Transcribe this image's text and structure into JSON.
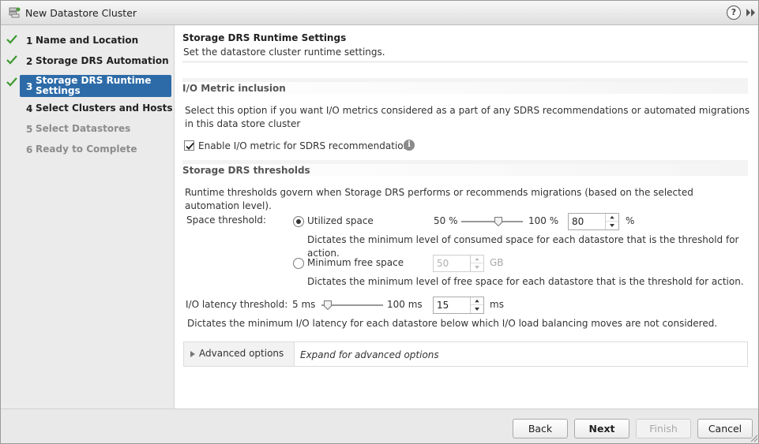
{
  "window": {
    "title": "New Datastore Cluster"
  },
  "steps": [
    {
      "num": "1",
      "label": "Name and Location",
      "state": "done"
    },
    {
      "num": "2",
      "label": "Storage DRS Automation",
      "state": "done"
    },
    {
      "num": "3",
      "label": "Storage DRS Runtime Settings",
      "state": "active"
    },
    {
      "num": "4",
      "label": "Select Clusters and Hosts",
      "state": "next"
    },
    {
      "num": "5",
      "label": "Select Datastores",
      "state": "disabled"
    },
    {
      "num": "6",
      "label": "Ready to Complete",
      "state": "disabled"
    }
  ],
  "page": {
    "title": "Storage DRS Runtime Settings",
    "subtitle": "Set the datastore cluster runtime settings."
  },
  "io_metric": {
    "heading": "I/O Metric inclusion",
    "description": "Select this option if you want I/O metrics considered as a part of any SDRS recommendations or automated migrations in this data store cluster",
    "checkbox_label": "Enable I/O metric for SDRS recommendations",
    "checked": true
  },
  "thresholds": {
    "heading": "Storage DRS thresholds",
    "description": "Runtime thresholds govern when Storage DRS performs or recommends migrations (based on the selected automation level).",
    "space_label": "Space threshold:",
    "utilized": {
      "label": "Utilized space",
      "selected": true,
      "min_label": "50 %",
      "max_label": "100 %",
      "value": "80",
      "unit": "%",
      "slider_fraction": 0.6,
      "help": "Dictates the minimum level of consumed space for each datastore that is the threshold for action."
    },
    "min_free": {
      "label": "Minimum free space",
      "selected": false,
      "value": "50",
      "unit": "GB",
      "help": "Dictates the minimum level of free space for each datastore that is the threshold for action."
    },
    "latency": {
      "label": "I/O latency threshold:",
      "min_label": "5 ms",
      "max_label": "100 ms",
      "value": "15",
      "unit": "ms",
      "slider_fraction": 0.1,
      "help": "Dictates the minimum I/O latency for each datastore below which I/O load balancing moves are not considered."
    }
  },
  "advanced": {
    "label": "Advanced options",
    "hint": "Expand for advanced options"
  },
  "buttons": {
    "back": "Back",
    "next": "Next",
    "finish": "Finish",
    "cancel": "Cancel"
  },
  "colors": {
    "active_step": "#2d6ba8",
    "check_green": "#3c9a2f"
  }
}
